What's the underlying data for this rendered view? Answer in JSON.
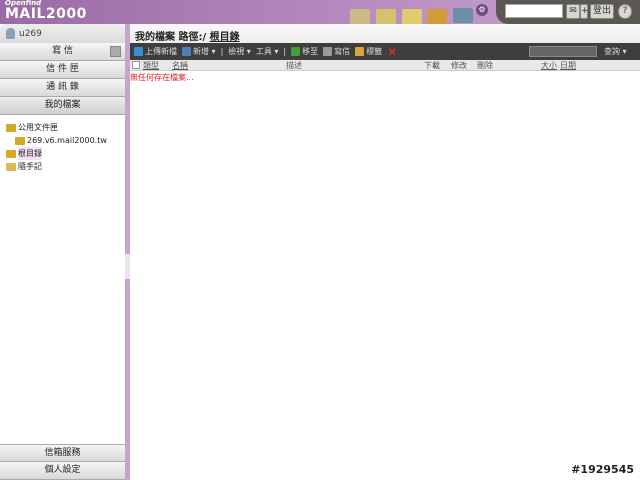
{
  "header": {
    "logo_small": "Openfind",
    "logo_big": "MAIL2000",
    "search_value": "",
    "logout": "登出",
    "help": "?",
    "advanced": "+"
  },
  "sidebar": {
    "user": "u269",
    "items": [
      {
        "label": "寫 信"
      },
      {
        "label": "信 件 匣"
      },
      {
        "label": "通 訊 錄"
      },
      {
        "label": "我的檔案"
      }
    ],
    "tree": [
      {
        "label": "公用文件匣"
      },
      {
        "label": "269.v6.mail2000.tw"
      },
      {
        "label": "根目錄"
      },
      {
        "label": "隨手記"
      }
    ],
    "bottom": [
      {
        "label": "信箱服務"
      },
      {
        "label": "個人設定"
      }
    ]
  },
  "main": {
    "title_prefix": "我的檔案 路徑:/ ",
    "title_path": "根目錄",
    "toolbar": {
      "upload": "上傳新檔",
      "new": "新增",
      "view": "檢視",
      "tools": "工具",
      "move": "移至",
      "write": "寫信",
      "tag": "標籤",
      "search": "查詢",
      "search_value": ""
    },
    "columns": [
      "類型",
      "名稱",
      "描述",
      "下載",
      "修改",
      "刪除",
      "大小",
      "日期"
    ],
    "empty": "無任何存在檔案..."
  },
  "watermark": "#1929545",
  "colors": {
    "header": "#9a6aa5",
    "toolbar": "#3f3e3c",
    "empty_text": "#e02020"
  }
}
